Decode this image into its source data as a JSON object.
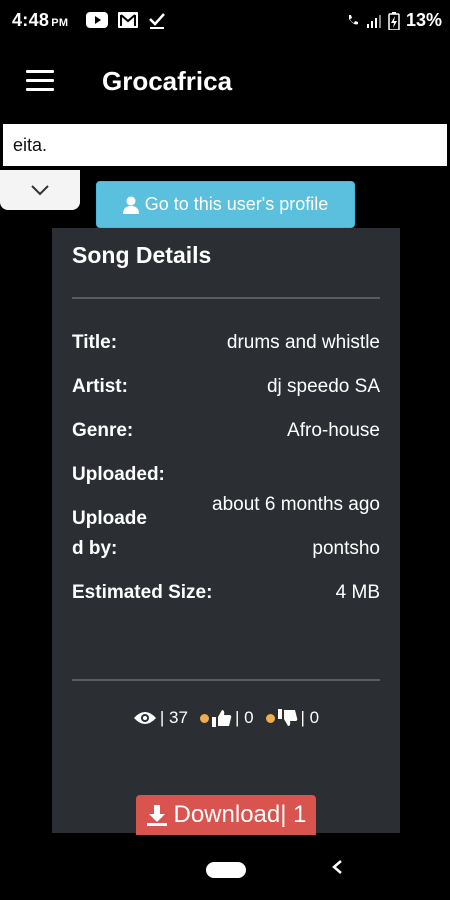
{
  "status_bar": {
    "time": "4:48",
    "ampm": "PM",
    "battery": "13%"
  },
  "app_bar": {
    "title": "Grocafrica"
  },
  "input": {
    "value": "eita."
  },
  "profile_button": {
    "label": "Go to this user's profile"
  },
  "card": {
    "title": "Song Details",
    "rows": [
      {
        "label": "Title:",
        "value": "drums and whistle"
      },
      {
        "label": "Artist:",
        "value": "dj speedo SA"
      },
      {
        "label": "Genre:",
        "value": "Afro-house"
      },
      {
        "label": "Uploaded:",
        "value": "about 6 months ago"
      },
      {
        "label": "Uploade",
        "label2": "d by:",
        "value": "pontsho"
      },
      {
        "label": "Estimated Size:",
        "value": "4 MB"
      }
    ],
    "stats": {
      "views": "| 37",
      "likes": "| 0",
      "dislikes": "| 0"
    },
    "download": {
      "label": "Download| 1"
    }
  },
  "colors": {
    "info": "#5bc0de",
    "danger": "#d9534f",
    "warning": "#f0ad4e",
    "card": "#2b2f33"
  },
  "icons": [
    "menu-icon",
    "user-icon",
    "eye-icon",
    "thumbs-up-icon",
    "thumbs-down-icon",
    "download-icon",
    "chevron-down-icon",
    "back-icon"
  ]
}
